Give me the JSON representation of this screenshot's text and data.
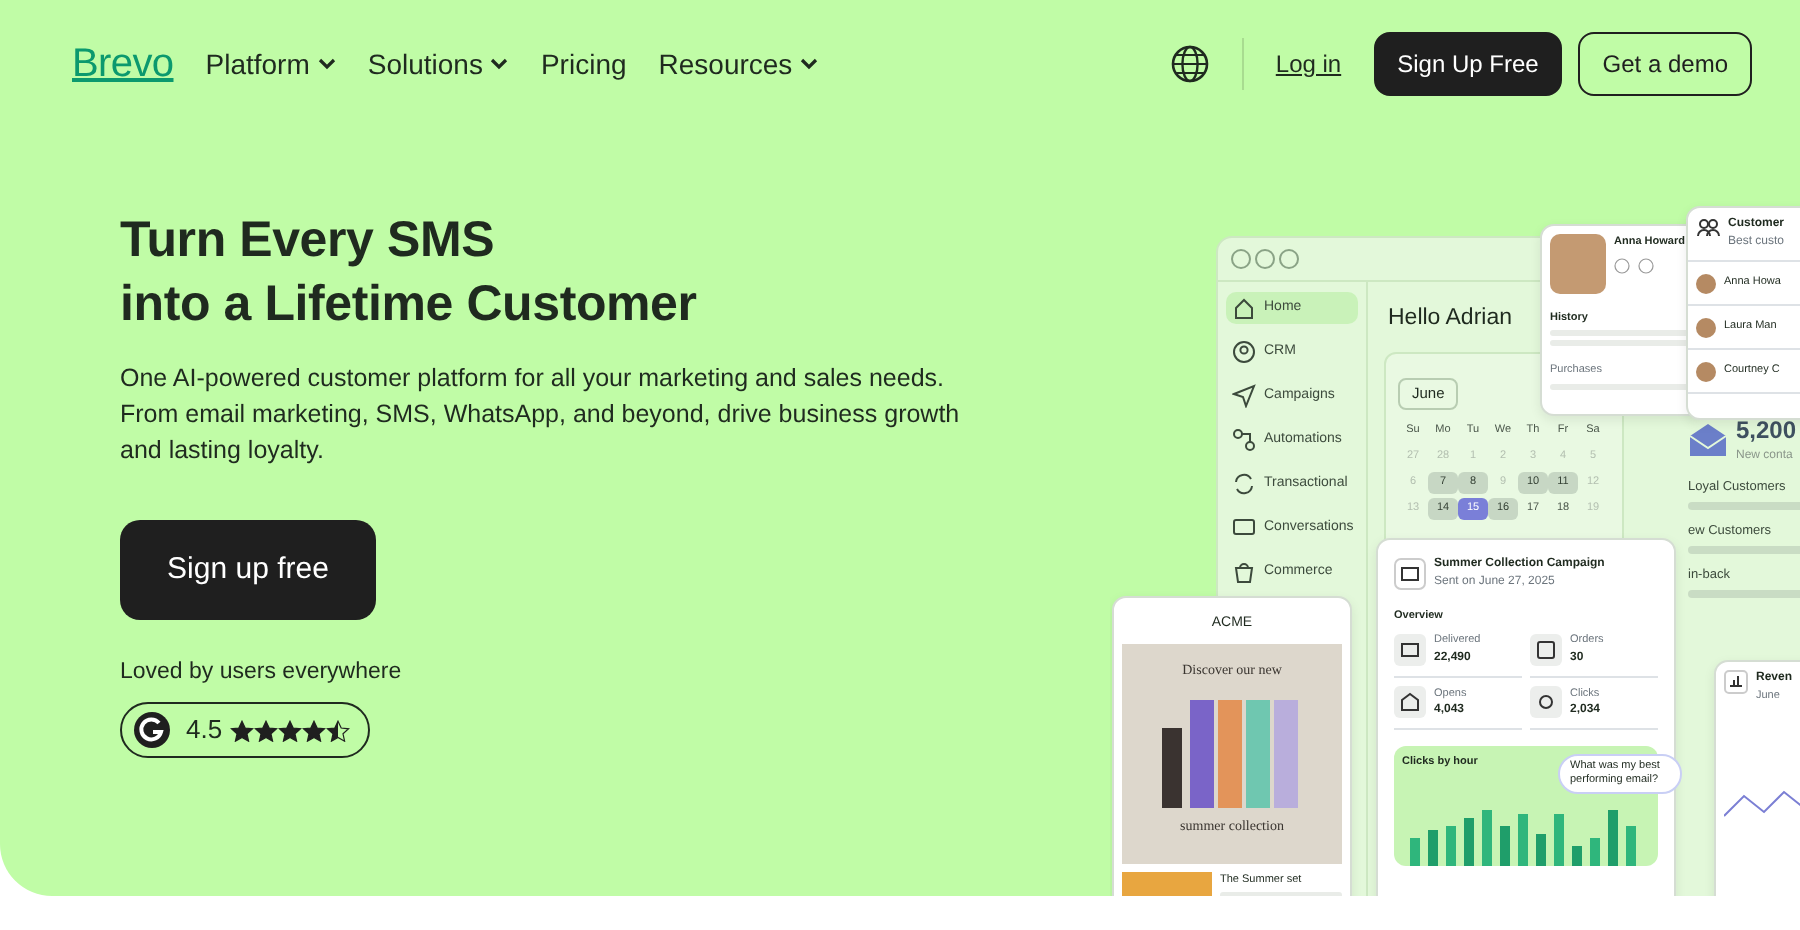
{
  "nav": {
    "logo": "Brevo",
    "menu": [
      {
        "label": "Platform",
        "dropdown": true
      },
      {
        "label": "Solutions",
        "dropdown": true
      },
      {
        "label": "Pricing",
        "dropdown": false
      },
      {
        "label": "Resources",
        "dropdown": true
      }
    ],
    "login": "Log in",
    "signup": "Sign Up Free",
    "demo": "Get a demo"
  },
  "hero": {
    "title_lines": [
      "Turn Every SMS",
      "into a Lifetime Customer"
    ],
    "description": "One AI-powered customer platform for all your marketing and sales needs. From email marketing, SMS, WhatsApp, and beyond, drive business growth and lasting loyalty.",
    "cta": "Sign up free",
    "rating_caption": "Loved by users everywhere",
    "rating": {
      "score": "4.5",
      "stars": 4.5
    }
  },
  "app_window": {
    "sidebar": [
      {
        "label": "Home",
        "selected": true
      },
      {
        "label": "CRM",
        "selected": false
      },
      {
        "label": "Campaigns",
        "selected": false
      },
      {
        "label": "Automations",
        "selected": false
      },
      {
        "label": "Transactional",
        "selected": false
      },
      {
        "label": "Conversations",
        "selected": false
      },
      {
        "label": "Commerce",
        "selected": false
      }
    ],
    "greeting": "Hello Adrian",
    "calendar": {
      "month": "June",
      "weekdays": [
        "Su",
        "Mo",
        "Tu",
        "We",
        "Th",
        "Fr",
        "Sa"
      ],
      "days": [
        {
          "day": "27",
          "kind": "faded"
        },
        {
          "day": "28",
          "kind": "faded"
        },
        {
          "day": "1",
          "kind": "faded"
        },
        {
          "day": "2",
          "kind": "faded"
        },
        {
          "day": "3",
          "kind": "faded"
        },
        {
          "day": "4",
          "kind": "faded"
        },
        {
          "day": "5",
          "kind": "faded"
        },
        {
          "day": "6",
          "kind": "faded"
        },
        {
          "day": "7",
          "kind": "marked"
        },
        {
          "day": "8",
          "kind": "marked"
        },
        {
          "day": "9",
          "kind": "faded"
        },
        {
          "day": "10",
          "kind": "marked"
        },
        {
          "day": "11",
          "kind": "marked"
        },
        {
          "day": "12",
          "kind": "faded"
        },
        {
          "day": "13",
          "kind": "faded"
        },
        {
          "day": "14",
          "kind": "marked"
        },
        {
          "day": "15",
          "kind": "today"
        },
        {
          "day": "16",
          "kind": "marked"
        },
        {
          "day": "17",
          "kind": "plain"
        },
        {
          "day": "18",
          "kind": "plain"
        },
        {
          "day": "19",
          "kind": "faded"
        }
      ]
    },
    "contacts": {
      "value": "5,200",
      "caption": "New conta"
    },
    "segments": [
      "Loyal Customers",
      "ew Customers",
      "in-back"
    ]
  },
  "profile_card": {
    "name": "Anna Howard",
    "history": "History",
    "purchases": "Purchases"
  },
  "customers_card": {
    "title": "Customer",
    "subtitle": "Best custo",
    "people": [
      "Anna Howa",
      "Laura Man",
      "Courtney C"
    ]
  },
  "campaign_card": {
    "title": "Summer Collection Campaign",
    "sent": "Sent on June 27, 2025",
    "overview": "Overview",
    "metrics": [
      {
        "label": "Delivered",
        "value": "22,490"
      },
      {
        "label": "Orders",
        "value": "30"
      },
      {
        "label": "Opens",
        "value": "4,043"
      },
      {
        "label": "Clicks",
        "value": "2,034"
      }
    ],
    "chart_title": "Clicks by hour",
    "assistant_prompt": "What was my best performing email?"
  },
  "email_card": {
    "brand": "ACME",
    "headline": "Discover our new",
    "tagline": "summer collection",
    "product": "The Summer set"
  },
  "revenue_card": {
    "title": "Reven",
    "subtitle": "June"
  }
}
